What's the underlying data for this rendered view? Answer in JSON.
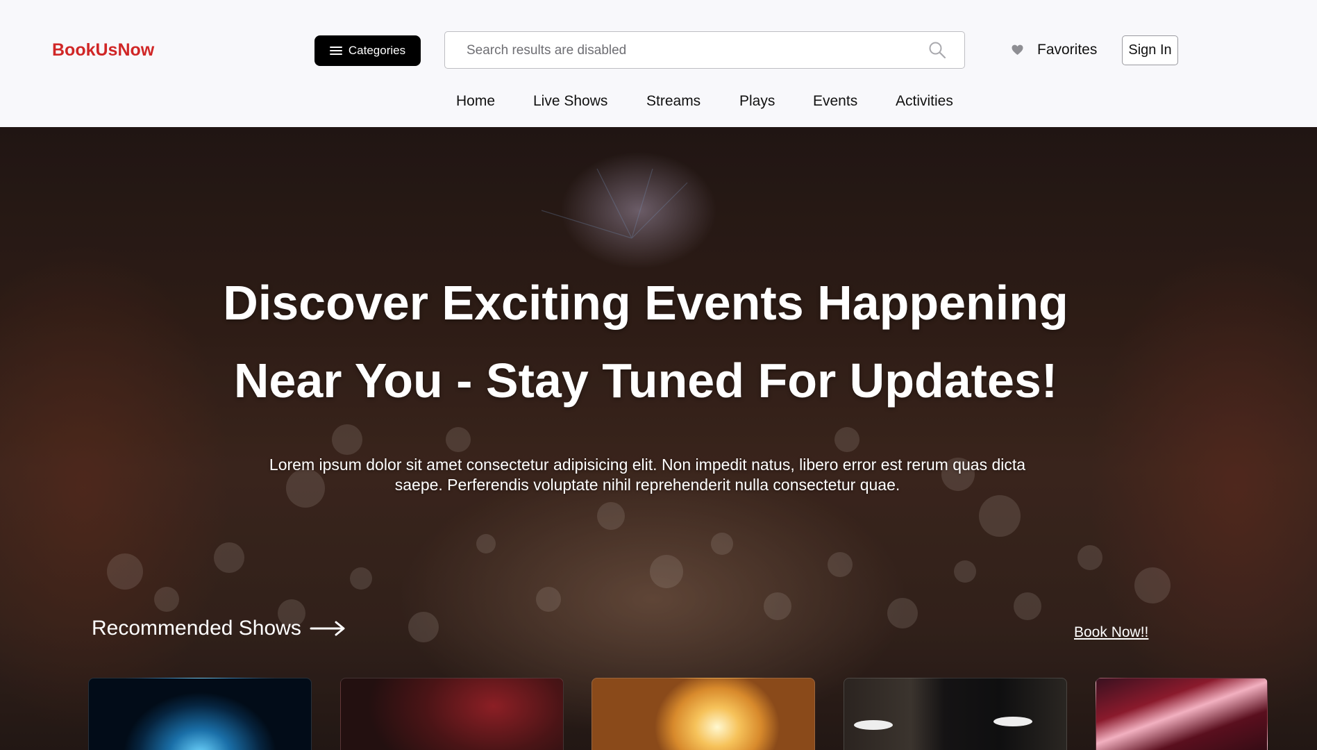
{
  "header": {
    "logo": "BookUsNow",
    "categories_label": "Categories",
    "search_placeholder": "Search results are disabled",
    "favorites_label": "Favorites",
    "signin_label": "Sign In"
  },
  "nav": {
    "items": [
      "Home",
      "Live Shows",
      "Streams",
      "Plays",
      "Events",
      "Activities"
    ]
  },
  "hero": {
    "title_line1": "Discover Exciting Events Happening",
    "title_line2": "Near You - Stay Tuned For Updates!",
    "subtitle": "Lorem ipsum dolor sit amet consectetur adipisicing elit. Non impedit natus, libero error est rerum quas dicta saepe. Perferendis voluptate nihil reprehenderit nulla consectetur quae.",
    "recommended_label": "Recommended Shows",
    "book_now_label": "Book Now!!"
  },
  "colors": {
    "brand": "#d02626",
    "button_bg": "#000000",
    "header_bg": "#f8f8fb"
  },
  "icons": [
    "hamburger-icon",
    "search-icon",
    "heart-icon",
    "arrow-right-icon"
  ]
}
